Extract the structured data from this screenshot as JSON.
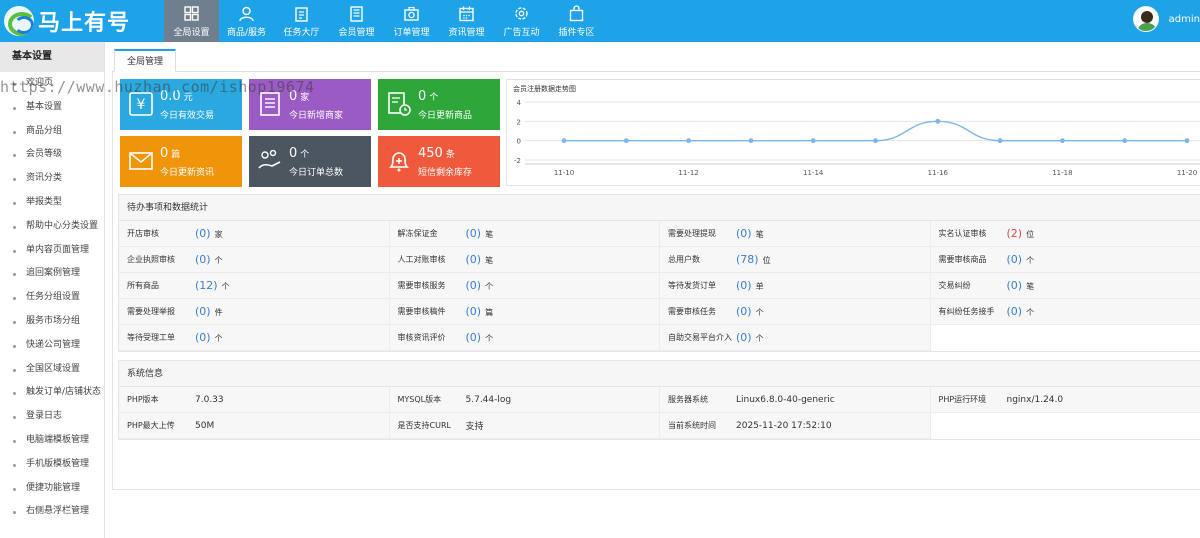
{
  "brand": {
    "name": "马上有号"
  },
  "nav": [
    {
      "label": "全局设置",
      "icon": "grid-icon",
      "active": true
    },
    {
      "label": "商品/服务",
      "icon": "user-icon"
    },
    {
      "label": "任务大厅",
      "icon": "clipboard-icon"
    },
    {
      "label": "会员管理",
      "icon": "list-icon"
    },
    {
      "label": "订单管理",
      "icon": "camera-icon"
    },
    {
      "label": "资讯管理",
      "icon": "calendar-icon"
    },
    {
      "label": "广告互动",
      "icon": "gear-icon"
    },
    {
      "label": "插件专区",
      "icon": "bag-icon"
    }
  ],
  "user": {
    "name": "admin"
  },
  "sidebar": {
    "title": "基本设置",
    "items": [
      "欢迎页",
      "基本设置",
      "商品分组",
      "会员等级",
      "资讯分类",
      "举报类型",
      "帮助中心分类设置",
      "单内容页面管理",
      "追回案例管理",
      "任务分组设置",
      "服务市场分组",
      "快递公司管理",
      "全国区域设置",
      "触发订单/店铺状态",
      "登录日志",
      "电脑端模板管理",
      "手机版模板管理",
      "便捷功能管理",
      "右侧悬浮栏管理"
    ]
  },
  "tab": {
    "label": "全局管理"
  },
  "tiles": [
    {
      "value": "0.0",
      "unit": "元",
      "label": "今日有效交易",
      "color": "#2aa8e0",
      "icon": "yen-icon"
    },
    {
      "value": "0",
      "unit": "家",
      "label": "今日新增商家",
      "color": "#9b5bc4",
      "icon": "document-icon"
    },
    {
      "value": "0",
      "unit": "个",
      "label": "今日更新商品",
      "color": "#2fa63a",
      "icon": "clock-doc-icon"
    },
    {
      "value": "0",
      "unit": "篇",
      "label": "今日更新资讯",
      "color": "#f0940a",
      "icon": "mail-icon"
    },
    {
      "value": "0",
      "unit": "个",
      "label": "今日订单总数",
      "color": "#4b5661",
      "icon": "hand-coins-icon"
    },
    {
      "value": "450",
      "unit": "条",
      "label": "短信剩余库存",
      "color": "#f05a3c",
      "icon": "bell-plus-icon"
    }
  ],
  "chart_data": {
    "type": "line",
    "title": "会员注册数据走势图",
    "x": [
      "11-10",
      "11-11",
      "11-12",
      "11-13",
      "11-14",
      "11-15",
      "11-16",
      "11-17",
      "11-18",
      "11-19",
      "11-20"
    ],
    "x_tick_labels": [
      "11-10",
      "11-12",
      "11-14",
      "11-16",
      "11-18",
      "11-20"
    ],
    "y_ticks": [
      "4",
      "2",
      "0",
      "-2"
    ],
    "series": [
      {
        "values": [
          0,
          0,
          0,
          0,
          0,
          0,
          2,
          0,
          0,
          0,
          0
        ]
      }
    ],
    "ylim": [
      -2,
      4
    ],
    "line_color": "#7cb5ec",
    "grid": true
  },
  "todo": {
    "title": "待办事项和数据统计",
    "rows": [
      [
        {
          "label": "开店审核",
          "value": "0",
          "unit": "家"
        },
        {
          "label": "解冻保证金",
          "value": "0",
          "unit": "笔"
        },
        {
          "label": "需要处理提现",
          "value": "0",
          "unit": "笔"
        },
        {
          "label": "实名认证审核",
          "value": "2",
          "unit": "位",
          "highlight": "#e04848"
        }
      ],
      [
        {
          "label": "企业执照审核",
          "value": "0",
          "unit": "个"
        },
        {
          "label": "人工对账审核",
          "value": "0",
          "unit": "笔"
        },
        {
          "label": "总用户数",
          "value": "78",
          "unit": "位"
        },
        {
          "label": "需要审核商品",
          "value": "0",
          "unit": "个"
        }
      ],
      [
        {
          "label": "所有商品",
          "value": "12",
          "unit": "个"
        },
        {
          "label": "需要审核服务",
          "value": "0",
          "unit": "个"
        },
        {
          "label": "等待发货订单",
          "value": "0",
          "unit": "单"
        },
        {
          "label": "交易纠纷",
          "value": "0",
          "unit": "笔"
        }
      ],
      [
        {
          "label": "需要处理举报",
          "value": "0",
          "unit": "件"
        },
        {
          "label": "需要审核稿件",
          "value": "0",
          "unit": "篇"
        },
        {
          "label": "需要审核任务",
          "value": "0",
          "unit": "个"
        },
        {
          "label": "有纠纷任务接手",
          "value": "0",
          "unit": "个"
        }
      ],
      [
        {
          "label": "等待受理工单",
          "value": "0",
          "unit": "个"
        },
        {
          "label": "审核资讯评价",
          "value": "0",
          "unit": "个"
        },
        {
          "label": "自助交易平台介入",
          "value": "0",
          "unit": "个"
        },
        null
      ]
    ]
  },
  "sysinfo": {
    "title": "系统信息",
    "rows": [
      [
        {
          "label": "PHP版本",
          "value": "7.0.33"
        },
        {
          "label": "MYSQL版本",
          "value": "5.7.44-log"
        },
        {
          "label": "服务器系统",
          "value": "Linux6.8.0-40-generic"
        },
        {
          "label": "PHP运行环境",
          "value": "nginx/1.24.0"
        }
      ],
      [
        {
          "label": "PHP最大上传",
          "value": "50M"
        },
        {
          "label": "是否支持CURL",
          "value": "支持"
        },
        {
          "label": "当前系统时间",
          "value": "2025-11-20 17:52:10"
        },
        null
      ]
    ]
  },
  "watermark": "https://www.huzhan.com/ishop19674"
}
